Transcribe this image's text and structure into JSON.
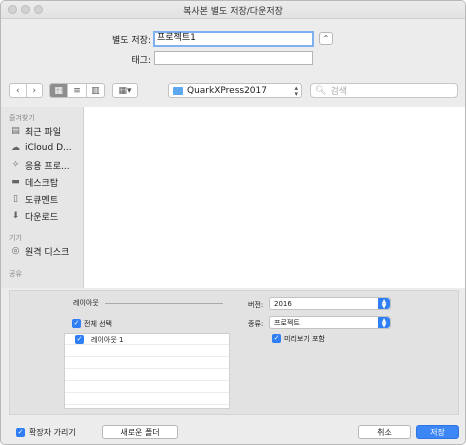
{
  "window": {
    "title": "복사본 별도 저장/다운저장"
  },
  "form": {
    "save_as_label": "별도 저장:",
    "save_as_value": "프로젝트1",
    "tags_label": "태그:",
    "tags_value": ""
  },
  "toolbar": {
    "location": "QuarkXPress2017",
    "search_placeholder": "검색"
  },
  "sidebar": {
    "favorites_header": "즐겨찾기",
    "favorites": [
      {
        "label": "최근 파일",
        "icon": "recent-icon"
      },
      {
        "label": "iCloud D...",
        "icon": "cloud-icon"
      },
      {
        "label": "응용 프로...",
        "icon": "applications-icon"
      },
      {
        "label": "데스크탑",
        "icon": "desktop-icon"
      },
      {
        "label": "도큐멘트",
        "icon": "documents-icon"
      },
      {
        "label": "다운로드",
        "icon": "downloads-icon"
      }
    ],
    "devices_header": "기기",
    "devices": [
      {
        "label": "원격 디스크",
        "icon": "disc-icon"
      }
    ],
    "shared_header": "공유"
  },
  "options": {
    "layouts_label": "레이아웃",
    "select_all_label": "전체 선택",
    "layouts": [
      "레이아웃 1"
    ],
    "version_label": "버전:",
    "version_value": "2016",
    "type_label": "종류:",
    "type_value": "프로젝트",
    "preview_label": "미리보기 포함"
  },
  "footer": {
    "hide_extension_label": "확장자 가리기",
    "new_folder_label": "새로운 폴더",
    "cancel_label": "취소",
    "save_label": "저장"
  },
  "colors": {
    "accent": "#2f7ef4",
    "focus_ring": "#7fb1f1"
  }
}
